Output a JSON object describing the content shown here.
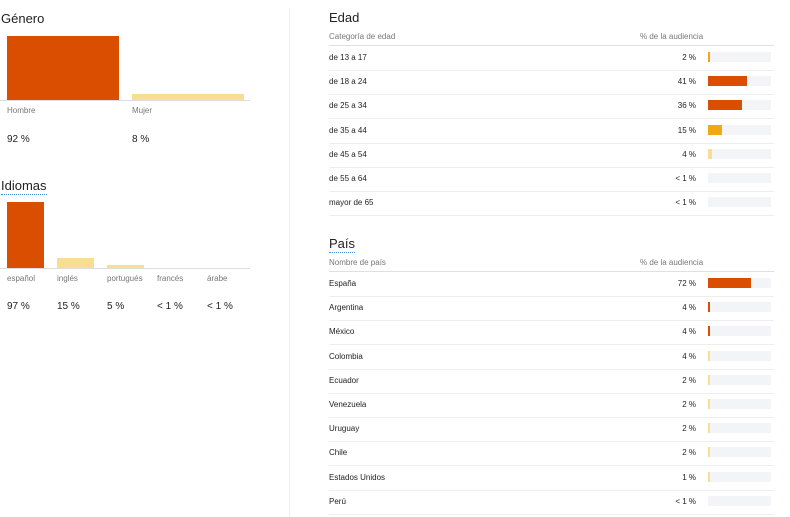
{
  "gender": {
    "title": "Género",
    "items": [
      {
        "label": "Hombre",
        "value_text": "92 %",
        "value": 92,
        "color": "#d94e00"
      },
      {
        "label": "Mujer",
        "value_text": "8 %",
        "value": 8,
        "color": "#f8de93"
      }
    ]
  },
  "languages": {
    "title": "Idiomas",
    "items": [
      {
        "label": "español",
        "value_text": "97 %",
        "value": 97,
        "color": "#d94e00"
      },
      {
        "label": "inglés",
        "value_text": "15 %",
        "value": 15,
        "color": "#f8de93"
      },
      {
        "label": "portugués",
        "value_text": "5 %",
        "value": 5,
        "color": "#f8de93"
      },
      {
        "label": "francés",
        "value_text": "< 1 %",
        "value": 0.5,
        "color": "#f8de93"
      },
      {
        "label": "árabe",
        "value_text": "< 1 %",
        "value": 0.5,
        "color": "#f8de93"
      }
    ]
  },
  "age": {
    "title": "Edad",
    "col_category": "Categoría de edad",
    "col_percent": "% de la audiencia",
    "rows": [
      {
        "label": "de 13 a 17",
        "value_text": "2 %",
        "value": 2,
        "color": "#f3a712"
      },
      {
        "label": "de 18 a 24",
        "value_text": "41 %",
        "value": 41,
        "color": "#d94e00"
      },
      {
        "label": "de 25 a 34",
        "value_text": "36 %",
        "value": 36,
        "color": "#d94e00"
      },
      {
        "label": "de 35 a 44",
        "value_text": "15 %",
        "value": 15,
        "color": "#f3a712"
      },
      {
        "label": "de 45 a 54",
        "value_text": "4 %",
        "value": 4,
        "color": "#f8de93"
      },
      {
        "label": "de 55 a 64",
        "value_text": "< 1 %",
        "value": 0,
        "color": "#f8de93"
      },
      {
        "label": "mayor de 65",
        "value_text": "< 1 %",
        "value": 0,
        "color": "#f8de93"
      }
    ]
  },
  "country": {
    "title": "País",
    "col_category": "Nombre de país",
    "col_percent": "% de la audiencia",
    "rows": [
      {
        "label": "España",
        "value_text": "72 %",
        "value": 72,
        "color": "#d94e00"
      },
      {
        "label": "Argentina",
        "value_text": "4 %",
        "value": 4,
        "color": "#d94e00"
      },
      {
        "label": "México",
        "value_text": "4 %",
        "value": 4,
        "color": "#d94e00"
      },
      {
        "label": "Colombia",
        "value_text": "4 %",
        "value": 4,
        "color": "#f8de93"
      },
      {
        "label": "Ecuador",
        "value_text": "2 %",
        "value": 2,
        "color": "#f8de93"
      },
      {
        "label": "Venezuela",
        "value_text": "2 %",
        "value": 2,
        "color": "#f8de93"
      },
      {
        "label": "Uruguay",
        "value_text": "2 %",
        "value": 2,
        "color": "#f8de93"
      },
      {
        "label": "Chile",
        "value_text": "2 %",
        "value": 2,
        "color": "#f8de93"
      },
      {
        "label": "Estados Unidos",
        "value_text": "1 %",
        "value": 1,
        "color": "#f8de93"
      },
      {
        "label": "Perú",
        "value_text": "< 1 %",
        "value": 0,
        "color": "#f8de93"
      }
    ]
  }
}
